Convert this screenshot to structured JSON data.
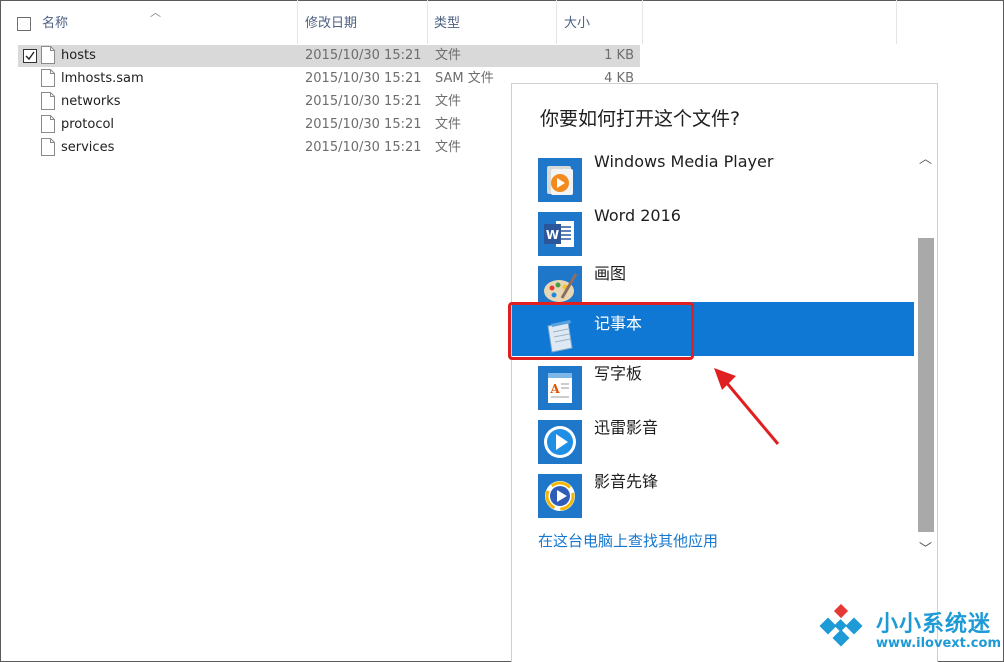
{
  "header": {
    "col_name": "名称",
    "col_date": "修改日期",
    "col_type": "类型",
    "col_size": "大小"
  },
  "files": [
    {
      "name": "hosts",
      "date": "2015/10/30 15:21",
      "type": "文件",
      "size": "1 KB",
      "selected": true
    },
    {
      "name": "lmhosts.sam",
      "date": "2015/10/30 15:21",
      "type": "SAM 文件",
      "size": "4 KB",
      "selected": false
    },
    {
      "name": "networks",
      "date": "2015/10/30 15:21",
      "type": "文件",
      "size": "",
      "selected": false
    },
    {
      "name": "protocol",
      "date": "2015/10/30 15:21",
      "type": "文件",
      "size": "",
      "selected": false
    },
    {
      "name": "services",
      "date": "2015/10/30 15:21",
      "type": "文件",
      "size": "",
      "selected": false
    }
  ],
  "dialog": {
    "title": "你要如何打开这个文件?",
    "apps": [
      {
        "label": "Windows Media Player",
        "icon": "windows-media-player-icon"
      },
      {
        "label": "Word 2016",
        "icon": "word-icon"
      },
      {
        "label": "画图",
        "icon": "paint-icon"
      },
      {
        "label": "记事本",
        "icon": "notepad-icon",
        "highlighted": true
      },
      {
        "label": "写字板",
        "icon": "wordpad-icon"
      },
      {
        "label": "迅雷影音",
        "icon": "xunlei-player-icon"
      },
      {
        "label": "影音先锋",
        "icon": "xfplay-icon"
      }
    ],
    "more_link": "在这台电脑上查找其他应用"
  },
  "watermark": {
    "title": "小小系统迷",
    "url": "www.ilovext.com"
  },
  "colors": {
    "highlight": "#0f78d4",
    "link": "#1778cf",
    "annotation_red": "#e02020",
    "watermark_blue": "#1e9ad6"
  }
}
